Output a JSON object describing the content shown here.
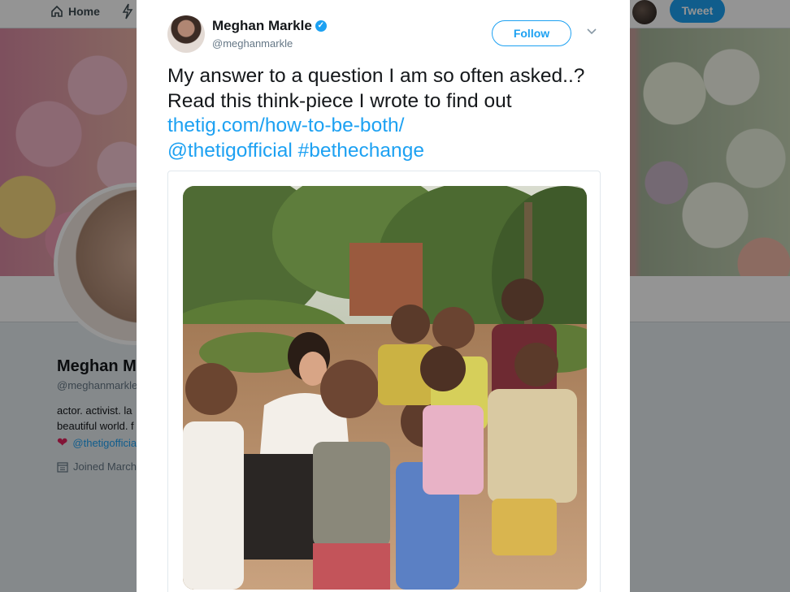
{
  "background": {
    "nav": {
      "home_label": "Home",
      "tweet_label": "Tweet"
    },
    "profile": {
      "name": "Meghan M",
      "handle": "@meghanmarkle",
      "bio_line1": "actor. activist. la",
      "bio_line2": "beautiful world. f",
      "link": "@thetigofficia",
      "joined": "Joined March"
    }
  },
  "tweet": {
    "author_name": "Meghan Markle",
    "author_handle": "@meghanmarkle",
    "follow_label": "Follow",
    "text_plain": "My answer to a question I am so often asked..?Read this think-piece I wrote to find out ",
    "link_url": "thetig.com/how-to-be-both/",
    "mention": "@thetigofficial",
    "hashtag": "#bethechange"
  },
  "icons": {
    "home": "home-icon",
    "moments": "lightning-icon",
    "verified": "verified-badge-icon",
    "caret": "chevron-down-icon",
    "heart": "heart-icon",
    "calendar": "calendar-icon"
  },
  "colors": {
    "accent": "#1da1f2",
    "text": "#14171a",
    "secondary": "#657786"
  }
}
